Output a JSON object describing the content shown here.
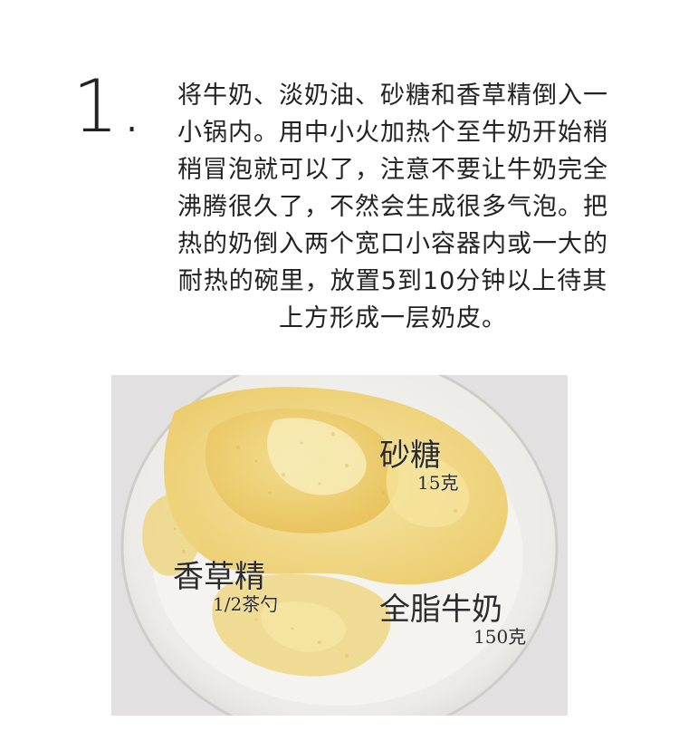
{
  "step": {
    "number": "1.",
    "text": "将牛奶、淡奶油、砂糖和香草精倒入一小锅内。用中小火加热个至牛奶开始稍稍冒泡就可以了，注意不要让牛奶完全沸腾很久了，不然会生成很多气泡。把热的奶倒入两个宽口小容器内或一大的耐热的碗里，放置5到10分钟以上待其上方形成一层奶皮。"
  },
  "photo": {
    "labels": {
      "sugar": {
        "name": "砂糖",
        "amount": "15克"
      },
      "vanilla": {
        "name": "香草精",
        "amount": "1/2茶勺"
      },
      "milk": {
        "name": "全脂牛奶",
        "amount": "150克"
      }
    }
  }
}
